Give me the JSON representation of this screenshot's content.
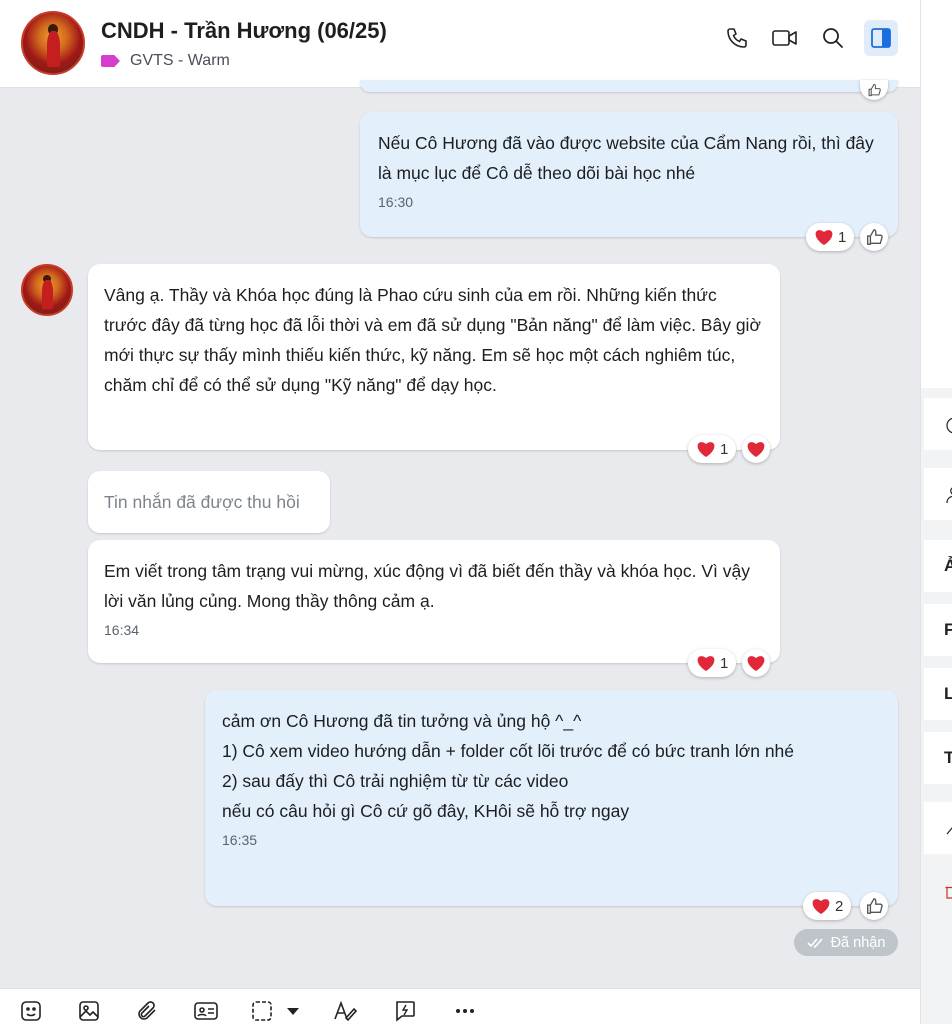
{
  "header": {
    "title": "CNDH - Trần Hương (06/25)",
    "tag_label": "GVTS - Warm",
    "tag_color": "#d63ed0",
    "icons": [
      "phone-icon",
      "video-call-icon",
      "search-icon",
      "sidebar-toggle-icon"
    ]
  },
  "messages": [
    {
      "side": "sent",
      "text": "Nếu Cô Hương đã vào được website của Cẩm Nang rồi, thì đây là mục lục để Cô dễ theo dõi bài học nhé",
      "time": "16:30",
      "reaction_count": "1"
    },
    {
      "side": "received",
      "text": "Vâng ạ. Thầy và Khóa học đúng là Phao cứu sinh của em rồi. Những kiến thức trước đây đã từng học đã lỗi thời và  em đã sử dụng \"Bản năng\" để làm việc. Bây giờ mới thực sự thấy mình thiếu kiến thức, kỹ năng. Em sẽ học một cách nghiêm túc, chăm chỉ để có thể sử dụng \"Kỹ năng\" để dạy học.",
      "reaction_count": "1"
    },
    {
      "side": "received",
      "recalled": true,
      "text": "Tin nhắn đã được thu hồi"
    },
    {
      "side": "received",
      "text": "Em viết trong tâm trạng vui mừng, xúc động vì đã biết đến thầy và khóa học. Vì vậy lời văn lủng củng. Mong thầy thông cảm ạ.",
      "time": "16:34",
      "reaction_count": "1"
    },
    {
      "side": "sent",
      "lines": [
        "cảm ơn Cô Hương đã tin tưởng và ủng hộ ^_^",
        "1) Cô xem video hướng dẫn + folder cốt lõi trước để có bức tranh lớn nhé",
        "2) sau đấy thì Cô trải nghiệm từ từ các video",
        "nếu có câu hỏi gì Cô cứ gõ đây, KHôi sẽ hỗ trợ ngay"
      ],
      "time": "16:35",
      "reaction_count": "2"
    }
  ],
  "status_text": "Đã nhận",
  "right_panel_letters": [
    "Ả",
    "F",
    "L",
    "T"
  ],
  "toolbar_icons": [
    "sticker-icon",
    "image-icon",
    "attachment-icon",
    "contact-card-icon",
    "screenshot-icon",
    "format-text-icon",
    "quick-message-icon",
    "more-icon"
  ],
  "colors": {
    "sent_bubble": "#e4effc",
    "received_bubble": "#ffffff",
    "chat_background": "#e9eaed",
    "heart": "#e0283a"
  }
}
